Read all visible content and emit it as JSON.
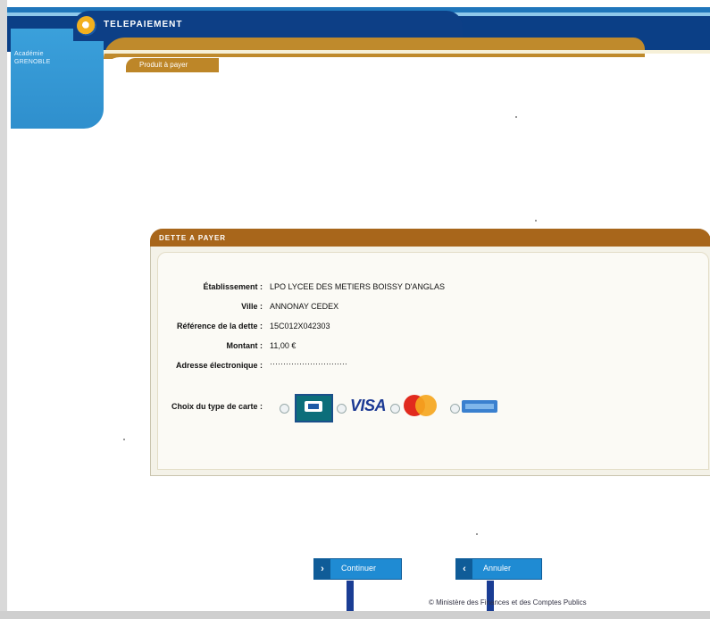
{
  "header": {
    "title": "TELEPAIEMENT",
    "side_label": "Académie GRENOBLE",
    "section_tab": "Produit à payer"
  },
  "debt": {
    "header": "DETTE A PAYER",
    "fields": [
      {
        "label": "Établissement :",
        "value": "LPO LYCEE DES METIERS BOISSY D'ANGLAS"
      },
      {
        "label": "Ville :",
        "value": "ANNONAY CEDEX"
      },
      {
        "label": "Référence de la dette :",
        "value": "15C012X042303"
      },
      {
        "label": "Montant :",
        "value": "11,00 €"
      },
      {
        "label": "Adresse électronique :",
        "value": "·····························"
      }
    ],
    "card_choice_label": "Choix du type de carte :",
    "cards": [
      {
        "name": "CB",
        "icon": "cb-card-icon"
      },
      {
        "name": "VISA",
        "icon": "visa-card-icon"
      },
      {
        "name": "MasterCard",
        "icon": "mastercard-card-icon"
      },
      {
        "name": "Maestro",
        "icon": "maestro-card-icon"
      }
    ]
  },
  "actions": {
    "continue_label": "Continuer",
    "cancel_label": "Annuler"
  },
  "footer": {
    "text": "© Ministère des Finances et des Comptes Publics"
  },
  "colors": {
    "header_blue": "#0b3f86",
    "gold": "#bf8a2c",
    "debt_header": "#a8661b",
    "button_blue": "#1f8bd3"
  }
}
